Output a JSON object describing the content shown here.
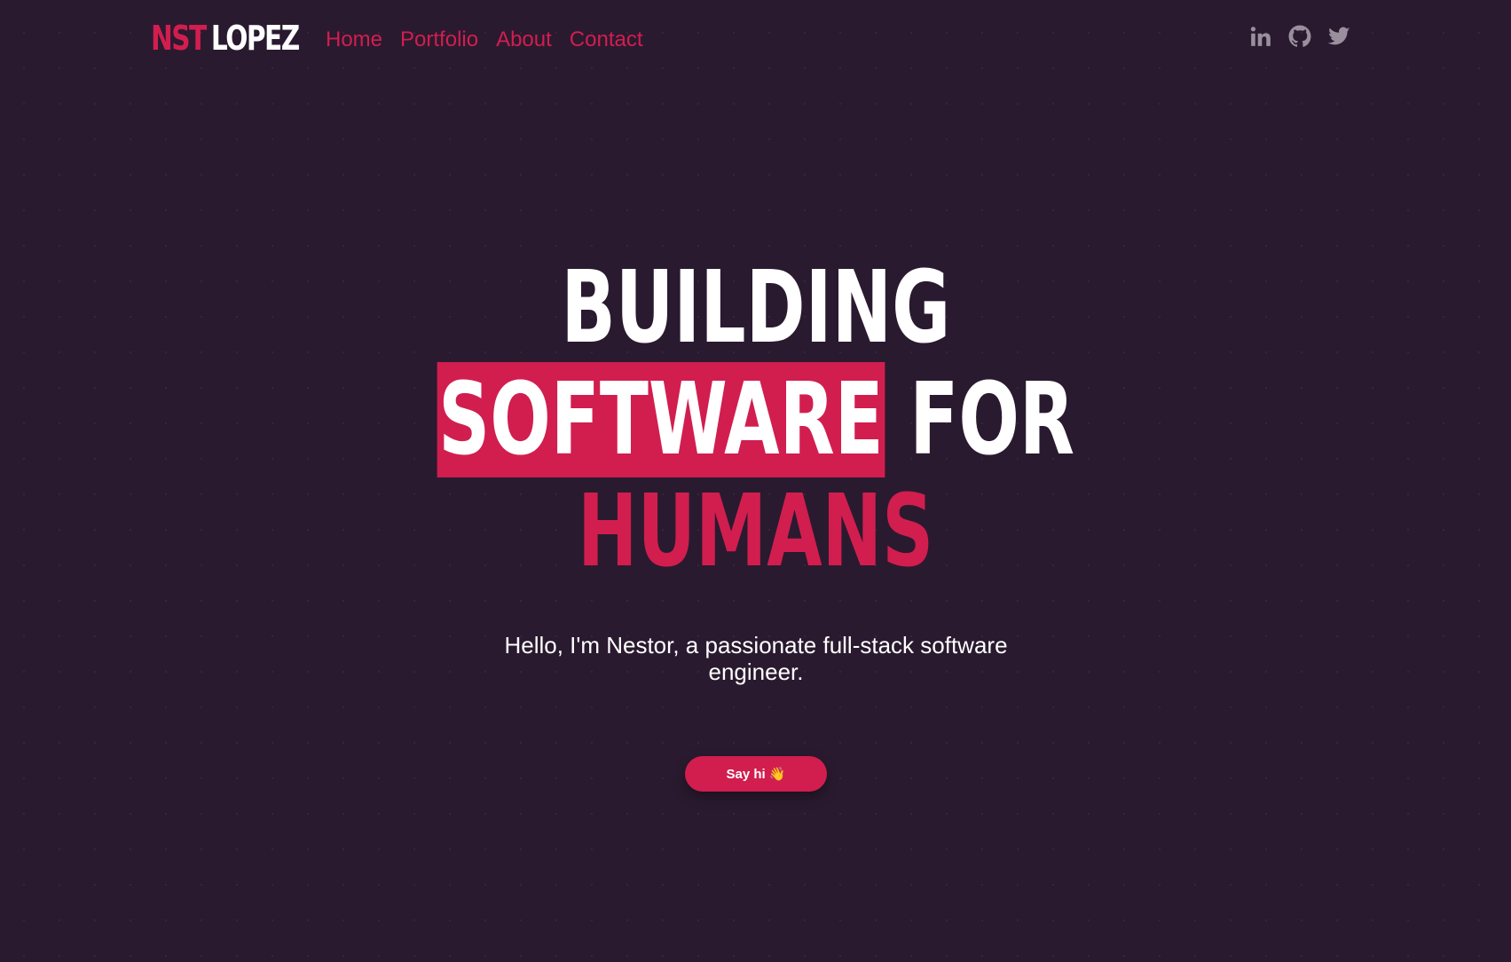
{
  "header": {
    "logo_first": "NST",
    "logo_second": "LOPEZ",
    "nav": [
      "Home",
      "Portfolio",
      "About",
      "Contact"
    ],
    "social": [
      "linkedin-icon",
      "github-icon",
      "twitter-icon"
    ]
  },
  "hero": {
    "line1": "BUILDING",
    "line2_highlight": "SOFTWARE",
    "line2_rest": " FOR",
    "line3": "HUMANS",
    "subtitle": "Hello, I'm Nestor, a passionate full-stack software engineer.",
    "cta_label": "Say hi 👋"
  },
  "colors": {
    "background": "#2a1a2f",
    "accent": "#d11e4f",
    "text": "#ffffff",
    "icon": "#9a8f9c"
  }
}
